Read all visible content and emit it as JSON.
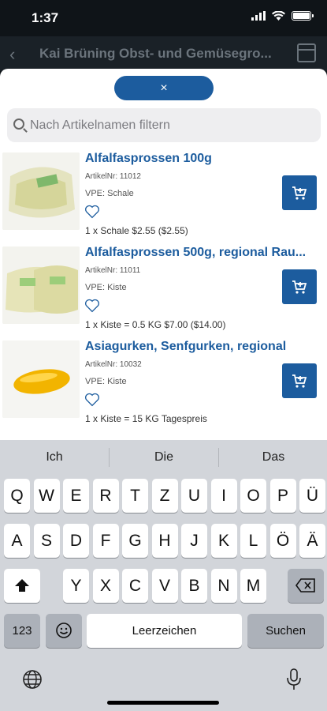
{
  "status": {
    "time": "1:37"
  },
  "header": {
    "title": "Kai Brüning Obst- und Gemüsegro..."
  },
  "sheet": {
    "close_label": "×"
  },
  "search": {
    "placeholder": "Nach Artikelnamen filtern",
    "value": ""
  },
  "products": [
    {
      "name": "Alfalfasprossen 100g",
      "nr": "ArtikelNr: 11012",
      "vpe": "VPE: Schale",
      "price": "1 x Schale $2.55 ($2.55)"
    },
    {
      "name": "Alfalfasprossen 500g, regional Rau...",
      "nr": "ArtikelNr: 11011",
      "vpe": "VPE: Kiste",
      "price": "1 x Kiste = 0.5 KG  $7.00 ($14.00)"
    },
    {
      "name": "Asiagurken, Senfgurken, regional",
      "nr": "ArtikelNr: 10032",
      "vpe": "VPE: Kiste",
      "price": "1 x Kiste = 15 KG Tagespreis"
    }
  ],
  "keyboard": {
    "suggestions": [
      "Ich",
      "Die",
      "Das"
    ],
    "row1": [
      "Q",
      "W",
      "E",
      "R",
      "T",
      "Z",
      "U",
      "I",
      "O",
      "P",
      "Ü"
    ],
    "row2": [
      "A",
      "S",
      "D",
      "F",
      "G",
      "H",
      "J",
      "K",
      "L",
      "Ö",
      "Ä"
    ],
    "row3": [
      "Y",
      "X",
      "C",
      "V",
      "B",
      "N",
      "M"
    ],
    "num_label": "123",
    "space_label": "Leerzeichen",
    "return_label": "Suchen"
  },
  "colors": {
    "accent": "#1c5c9e"
  }
}
